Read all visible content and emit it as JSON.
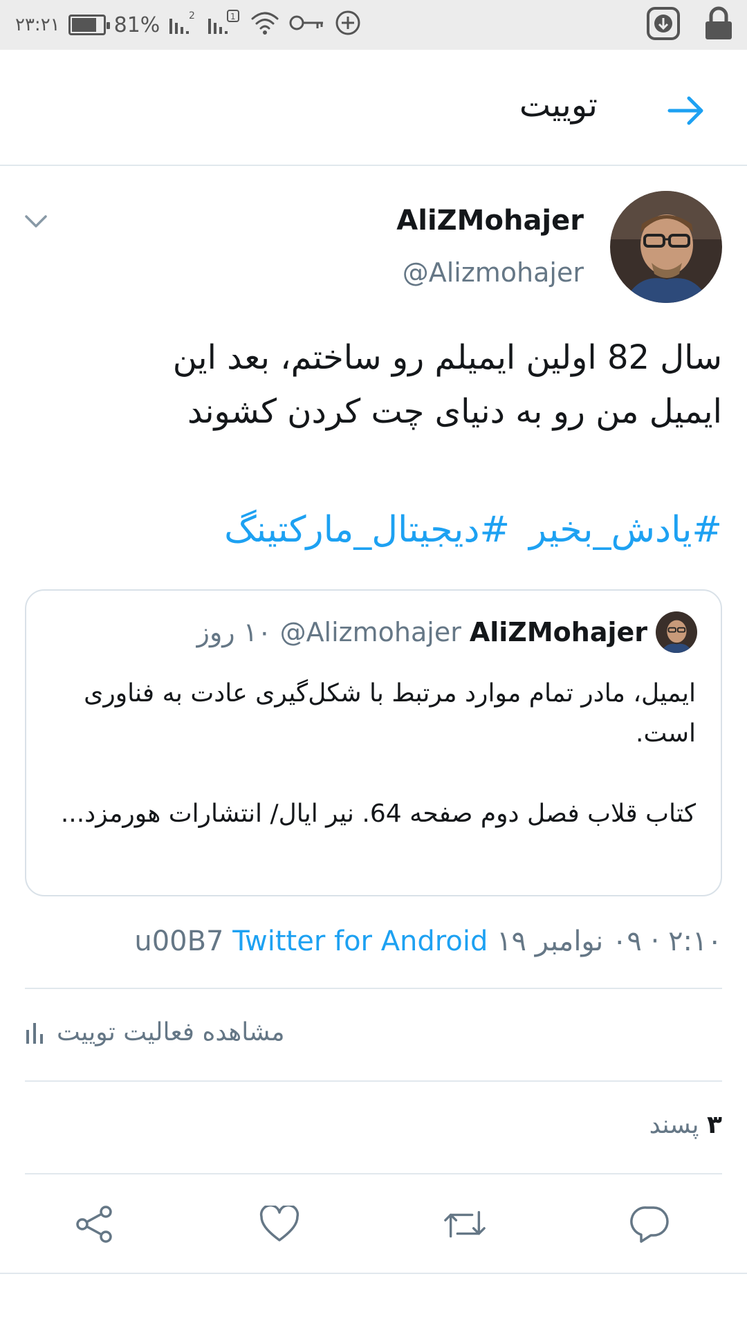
{
  "status_bar": {
    "time": "۲۳:۲۱",
    "battery_percent": "81%",
    "battery_level": 0.81,
    "icons": [
      "battery-icon",
      "signal-sim2-icon",
      "signal-sim1-icon",
      "wifi-icon",
      "vpn-key-icon",
      "data-saver-icon",
      "download-icon",
      "lock-icon"
    ]
  },
  "header": {
    "title": "توییت"
  },
  "tweet": {
    "author_name": "AliZMohajer",
    "author_handle": "@Alizmohajer",
    "text_line1": "سال 82 اولین ایمیلم رو ساختم، بعد این",
    "text_line2": "ایمیل من رو به دنیای چت کردن کشوند",
    "hashtags": [
      "#یادش_بخیر",
      "#دیجیتال_مارکتینگ"
    ],
    "timestamp": "۲:۱۰ · ۰۹ نوامبر ۱۹",
    "via_sep": "u00B7",
    "source": "Twitter for Android",
    "activity_label": "مشاهده فعالیت توییت",
    "likes_count": "۳",
    "likes_label": "پسند"
  },
  "quoted_tweet": {
    "author_name": "AliZMohajer",
    "author_handle": "@Alizmohajer",
    "time_ago": "۱۰ روز",
    "paragraph1": "ایمیل، مادر تمام موارد مرتبط با شکل‌گیری عادت به فناوری است.",
    "paragraph2": "کتاب قلاب فصل دوم صفحه 64. نیر ایال/ انتشارات هورمزد..."
  },
  "actions": [
    "share-icon",
    "like-icon",
    "retweet-icon",
    "reply-icon"
  ],
  "colors": {
    "accent": "#1da1f2",
    "secondary_text": "#657786",
    "divider": "#e1e8ed"
  }
}
